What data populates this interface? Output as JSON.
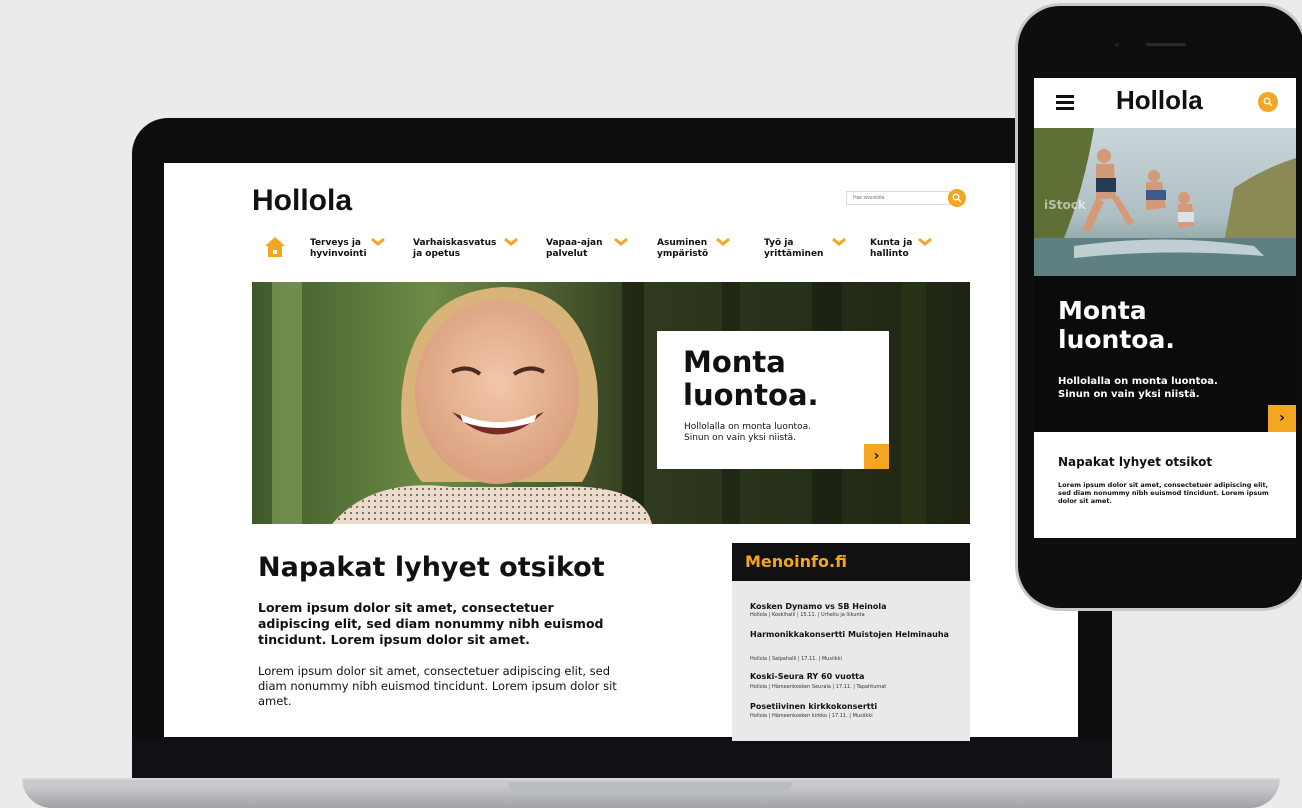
{
  "colors": {
    "accent": "#f4a623",
    "dark": "#111111",
    "background": "#ebebeb"
  },
  "desktop": {
    "logo": "Hollola",
    "search": {
      "placeholder": "Hae sivustolta"
    },
    "nav": {
      "home_icon": "home-icon",
      "items": [
        {
          "label": "Terveys ja hyvinvointi",
          "line1": "Terveys ja",
          "line2": "hyvinvointi"
        },
        {
          "label": "Varhaiskasvatus ja opetus",
          "line1": "Varhaiskasvatus",
          "line2": "ja opetus"
        },
        {
          "label": "Vapaa-ajan palvelut",
          "line1": "Vapaa-ajan",
          "line2": "palvelut"
        },
        {
          "label": "Asuminen ympäristö",
          "line1": "Asuminen",
          "line2": "ympäristö"
        },
        {
          "label": "Työ ja yrittäminen",
          "line1": "Työ ja",
          "line2": "yrittäminen"
        },
        {
          "label": "Kunta ja hallinto",
          "line1": "Kunta ja",
          "line2": "hallinto"
        }
      ]
    },
    "hero": {
      "title_line1": "Monta",
      "title_line2": "luontoa.",
      "subtitle_line1": "Hollolalla on monta luontoa.",
      "subtitle_line2": "Sinun on vain yksi niistä.",
      "button_icon": "›"
    },
    "content": {
      "heading": "Napakat lyhyet otsikot",
      "lead": "Lorem ipsum dolor sit amet, consectetuer adipiscing elit, sed diam nonummy nibh euismod tincidunt. Lorem ipsum dolor sit amet.",
      "body": "Lorem ipsum dolor sit amet, consectetuer adipiscing elit, sed diam nonummy nibh euismod tincidunt. Lorem ipsum dolor sit amet."
    },
    "menoinfo": {
      "title": "Menoinfo.fi",
      "events": [
        {
          "title": "Kosken Dynamo vs SB Heinola",
          "meta": "Hollola | Koskihalli | 15.11. | Urheilu ja liikunta"
        },
        {
          "title": "Harmonikkakonsertti Muistojen Helminauha",
          "meta": "Hollola | Salpahalli | 17.11. | Musiikki"
        },
        {
          "title": "Koski-Seura RY 60 vuotta",
          "meta": "Hollola | Hämeenkosken Seurala | 17.11. | Tapahtumat"
        },
        {
          "title": "Posetiivinen kirkkokonsertti",
          "meta": "Hollola | Hämeenkosken kirkko | 17.11. | Musiikki"
        }
      ]
    }
  },
  "mobile": {
    "logo": "Hollola",
    "menu_icon": "hamburger-icon",
    "search_icon": "search-icon",
    "hero_watermark": "iStock",
    "hero": {
      "title_line1": "Monta",
      "title_line2": "luontoa.",
      "subtitle_line1": "Hollolalla on monta luontoa.",
      "subtitle_line2": "Sinun on vain yksi niistä.",
      "button_icon": "›"
    },
    "content": {
      "heading": "Napakat lyhyet otsikot",
      "body": "Lorem ipsum dolor sit amet, consectetuer adipiscing elit, sed diam nonummy nibh euismod tincidunt. Lorem ipsum dolor sit amet."
    }
  }
}
